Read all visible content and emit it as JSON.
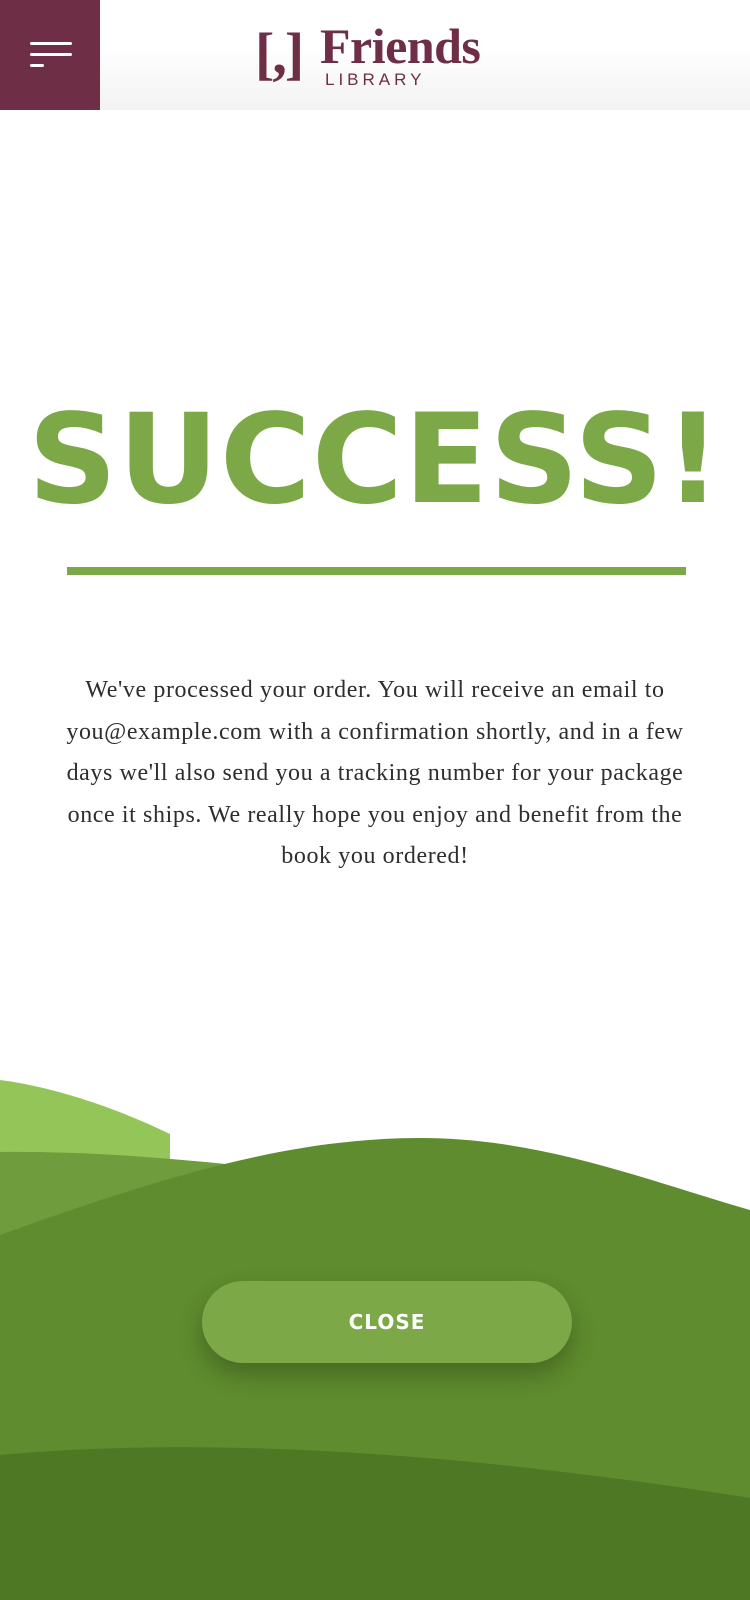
{
  "header": {
    "menu_icon": "hamburger-menu-icon",
    "logo": {
      "mark": "[,]",
      "word": "Friends",
      "sub": "LIBRARY"
    }
  },
  "main": {
    "headline": "SUCCESS!",
    "message": "We've processed your order. You will receive an email to you@example.com with a confirmation shortly, and in a few days we'll also send you a tracking number for your package once it ships. We really hope you enjoy and benefit from the book you ordered!"
  },
  "footer": {
    "close_label": "CLOSE"
  },
  "colors": {
    "brand_maroon": "#6d2e46",
    "accent_green": "#7ca848",
    "hill_light": "#93c558",
    "hill_mid": "#6f9c3c",
    "hill_main": "#5f8c2e",
    "hill_dark": "#4e7824"
  }
}
